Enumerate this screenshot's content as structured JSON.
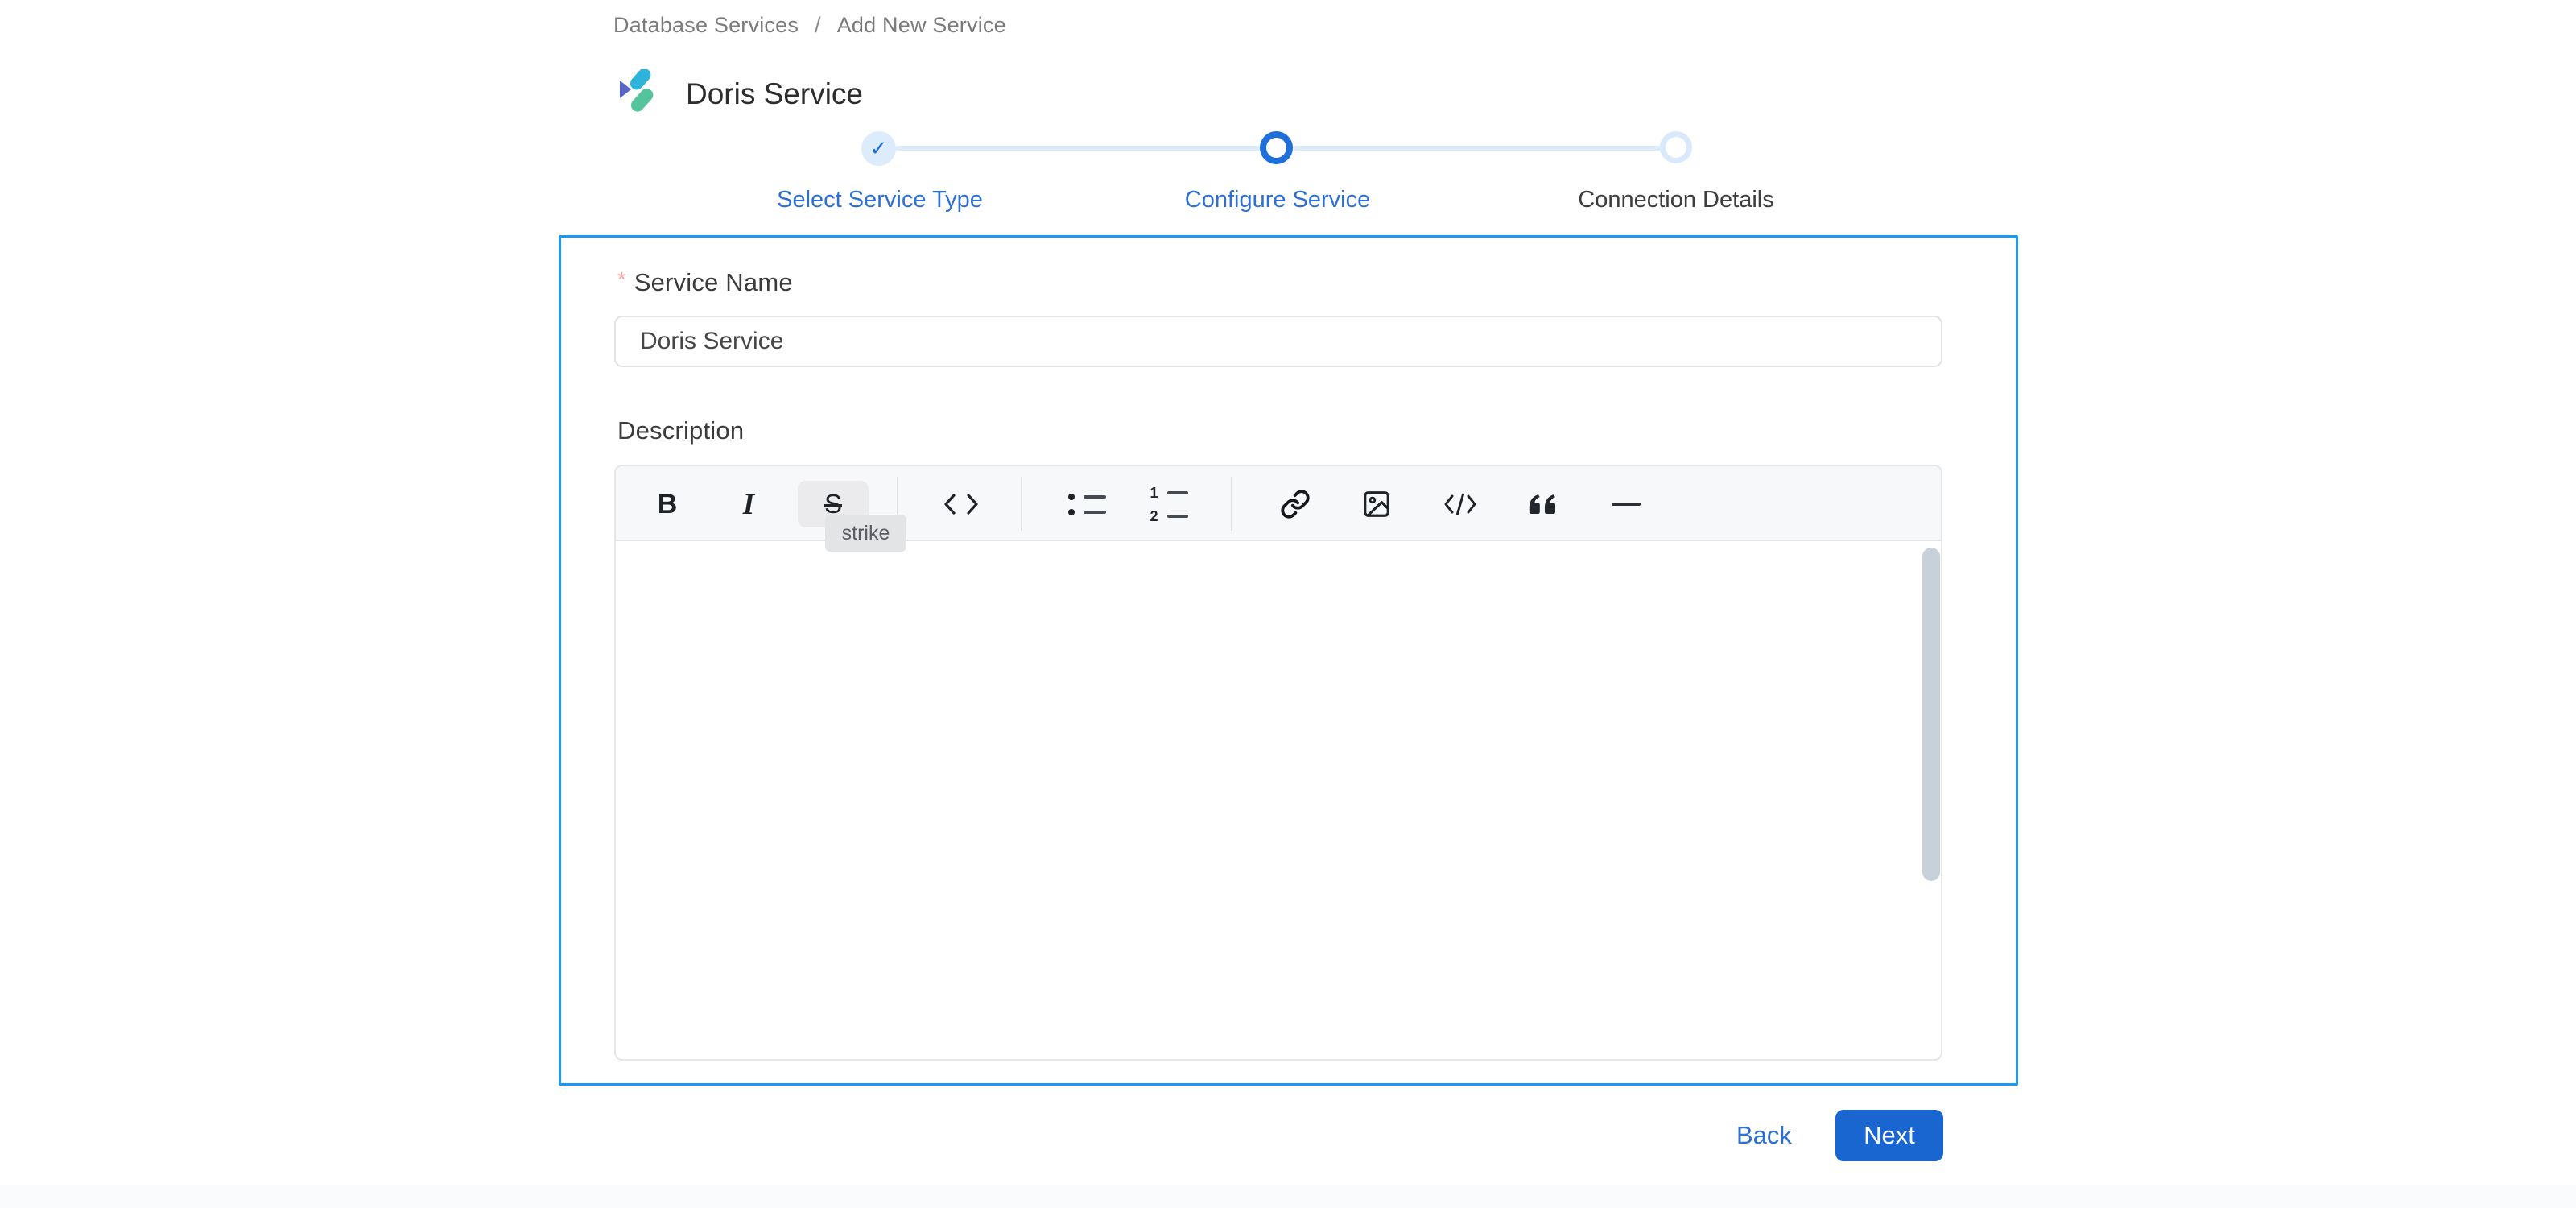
{
  "breadcrumb": {
    "items": [
      "Database Services",
      "Add New Service"
    ],
    "separator": "/"
  },
  "header": {
    "title": "Doris Service",
    "logo": "doris-logo"
  },
  "stepper": {
    "steps": [
      {
        "label": "Select Service Type",
        "state": "completed",
        "icon": "check"
      },
      {
        "label": "Configure Service",
        "state": "active"
      },
      {
        "label": "Connection Details",
        "state": "pending"
      }
    ],
    "check_glyph": "✓"
  },
  "form": {
    "service_name": {
      "label": "Service Name",
      "required_marker": "*",
      "value": "Doris Service"
    },
    "description": {
      "label": "Description",
      "value": "",
      "toolbar": {
        "bold_glyph": "B",
        "italic_glyph": "I",
        "strike_glyph": "S",
        "ordered_list_numbers": [
          "1",
          "2"
        ],
        "tools": [
          "bold",
          "italic",
          "strike",
          "inline-code",
          "bullet-list",
          "ordered-list",
          "link",
          "image",
          "code-block",
          "blockquote",
          "horizontal-rule"
        ],
        "active_tool": "strike",
        "tooltip": {
          "text": "strike",
          "for": "strike"
        }
      }
    }
  },
  "actions": {
    "back": "Back",
    "next": "Next"
  },
  "colors": {
    "accent_blue": "#2e6fd6",
    "button_blue": "#1a66d1",
    "card_focus_border": "#1b9af2",
    "step_done_bg": "#ddecfb",
    "step_pending_ring": "#d9e9fb",
    "connector_blue": "#dcebfa",
    "required_red": "#f7a2a2",
    "icon_dark": "#1f2328",
    "toolbar_bg": "#f7f8fa",
    "tooltip_bg": "#e3e4e6",
    "tooltip_text": "#595c61",
    "scrollbar_thumb": "#c8d1da",
    "logo_cyan": "#2fb3da",
    "logo_purple": "#5767c3",
    "logo_green": "#55c49c"
  }
}
